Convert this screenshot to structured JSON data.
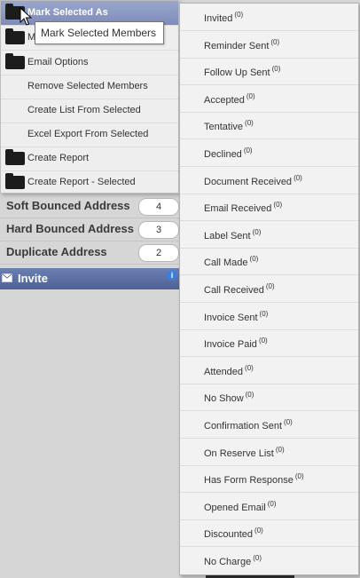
{
  "context_menu": {
    "items": [
      {
        "label": "Mark Selected As",
        "has_icon": true,
        "active": true
      },
      {
        "label": "Mark Selected Members",
        "has_icon": true
      },
      {
        "label": "Email Options",
        "has_icon": true
      },
      {
        "label": "Remove Selected Members",
        "has_icon": false
      },
      {
        "label": "Create List From Selected",
        "has_icon": false
      },
      {
        "label": "Excel Export From Selected",
        "has_icon": false
      },
      {
        "label": "Create Report",
        "has_icon": true
      },
      {
        "label": "Create Report - Selected",
        "has_icon": true
      }
    ],
    "partial_item_2_visible": "M",
    "tooltip": "Mark Selected Members"
  },
  "status_submenu": {
    "items": [
      {
        "label": "Invited",
        "count": "(0)"
      },
      {
        "label": "Reminder Sent",
        "count": "(0)"
      },
      {
        "label": "Follow Up Sent",
        "count": "(0)"
      },
      {
        "label": "Accepted",
        "count": "(0)"
      },
      {
        "label": "Tentative",
        "count": "(0)"
      },
      {
        "label": "Declined",
        "count": "(0)"
      },
      {
        "label": "Document Received",
        "count": "(0)"
      },
      {
        "label": "Email Received",
        "count": "(0)"
      },
      {
        "label": "Label Sent",
        "count": "(0)"
      },
      {
        "label": "Call Made",
        "count": "(0)"
      },
      {
        "label": "Call Received",
        "count": "(0)"
      },
      {
        "label": "Invoice Sent",
        "count": "(0)"
      },
      {
        "label": "Invoice Paid",
        "count": "(0)"
      },
      {
        "label": "Attended",
        "count": "(0)"
      },
      {
        "label": "No Show",
        "count": "(0)"
      },
      {
        "label": "Confirmation Sent",
        "count": "(0)"
      },
      {
        "label": "On Reserve List",
        "count": "(0)"
      },
      {
        "label": "Has Form Response",
        "count": "(0)"
      },
      {
        "label": "Opened Email",
        "count": "(0)"
      },
      {
        "label": "Discounted",
        "count": "(0)"
      },
      {
        "label": "No Charge",
        "count": "(0)"
      }
    ]
  },
  "background_list": {
    "rows": [
      {
        "label": "Soft Bounced Address",
        "count": "4"
      },
      {
        "label": "Hard Bounced Address",
        "count": "3"
      },
      {
        "label": "Duplicate Address",
        "count": "2"
      }
    ],
    "invite_label": "Invite",
    "info_glyph": "i"
  },
  "colors": {
    "menu_active": "#8c98c4",
    "invite_bar": "#5b6fa3"
  }
}
